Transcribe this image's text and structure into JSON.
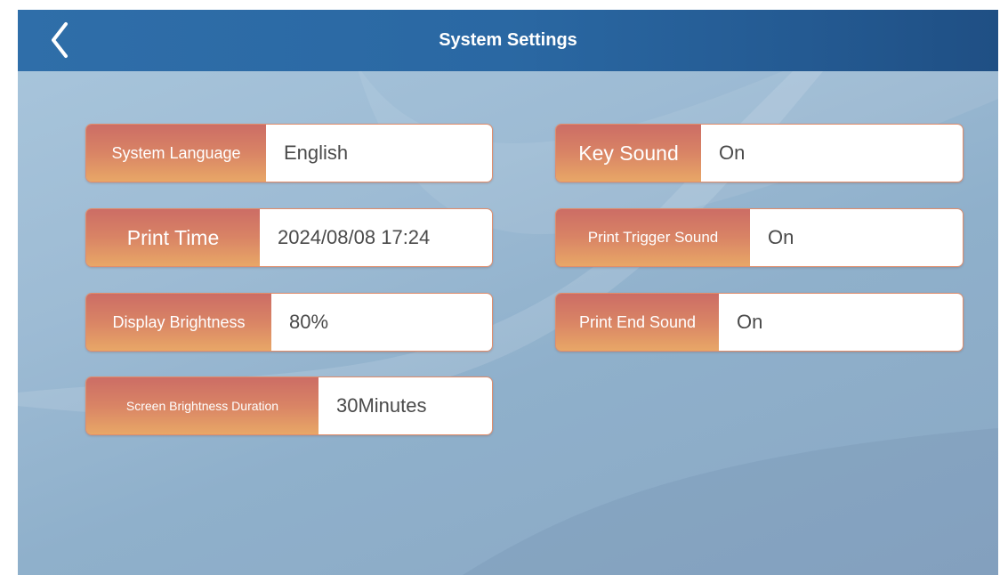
{
  "header": {
    "title": "System Settings",
    "back_icon": "chevron-left-icon"
  },
  "left_settings": [
    {
      "label": "System Language",
      "value": "English"
    },
    {
      "label": "Print Time",
      "value": "2024/08/08 17:24"
    },
    {
      "label": "Display Brightness",
      "value": "80%"
    },
    {
      "label": "Screen Brightness Duration",
      "value": "30Minutes"
    }
  ],
  "right_settings": [
    {
      "label": "Key Sound",
      "value": "On"
    },
    {
      "label": "Print Trigger Sound",
      "value": "On"
    },
    {
      "label": "Print End Sound",
      "value": "On"
    }
  ],
  "colors": {
    "header": "#2a68a3",
    "label_top": "#cc6d65",
    "label_bottom": "#e8a767",
    "background": "#9dbbd4"
  }
}
